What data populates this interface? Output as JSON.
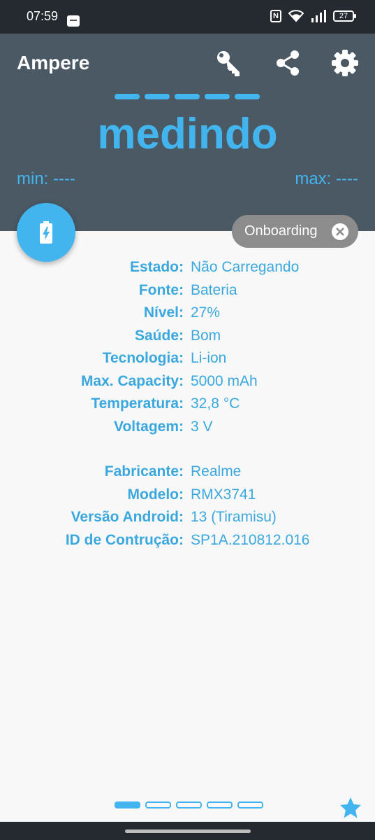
{
  "status_bar": {
    "time": "07:59",
    "battery": "27",
    "icons": [
      "notification-icon",
      "nfc-icon",
      "wifi-icon",
      "signal-icon",
      "battery-icon"
    ]
  },
  "header": {
    "title": "Ampere",
    "actions": [
      "key-icon",
      "share-icon",
      "gear-icon"
    ],
    "reading": "medindo",
    "min_label": "min: ----",
    "max_label": "max: ----",
    "accent": "#42b5ef",
    "background": "#4a5964"
  },
  "onboarding_chip": {
    "label": "Onboarding"
  },
  "info": {
    "battery": [
      {
        "label": "Estado:",
        "value": "Não Carregando"
      },
      {
        "label": "Fonte:",
        "value": "Bateria"
      },
      {
        "label": "Nível:",
        "value": "27%"
      },
      {
        "label": "Saúde:",
        "value": "Bom"
      },
      {
        "label": "Tecnologia:",
        "value": "Li-ion"
      },
      {
        "label": "Max. Capacity:",
        "value": "5000 mAh"
      },
      {
        "label": "Temperatura:",
        "value": "32,8 °C"
      },
      {
        "label": "Voltagem:",
        "value": "3 V"
      }
    ],
    "device": [
      {
        "label": "Fabricante:",
        "value": "Realme"
      },
      {
        "label": "Modelo:",
        "value": "RMX3741"
      },
      {
        "label": "Versão Android:",
        "value": "13 (Tiramisu)"
      },
      {
        "label": "ID de Contrução:",
        "value": "SP1A.210812.016"
      }
    ]
  },
  "pager": {
    "pages": 5,
    "active": 1
  }
}
